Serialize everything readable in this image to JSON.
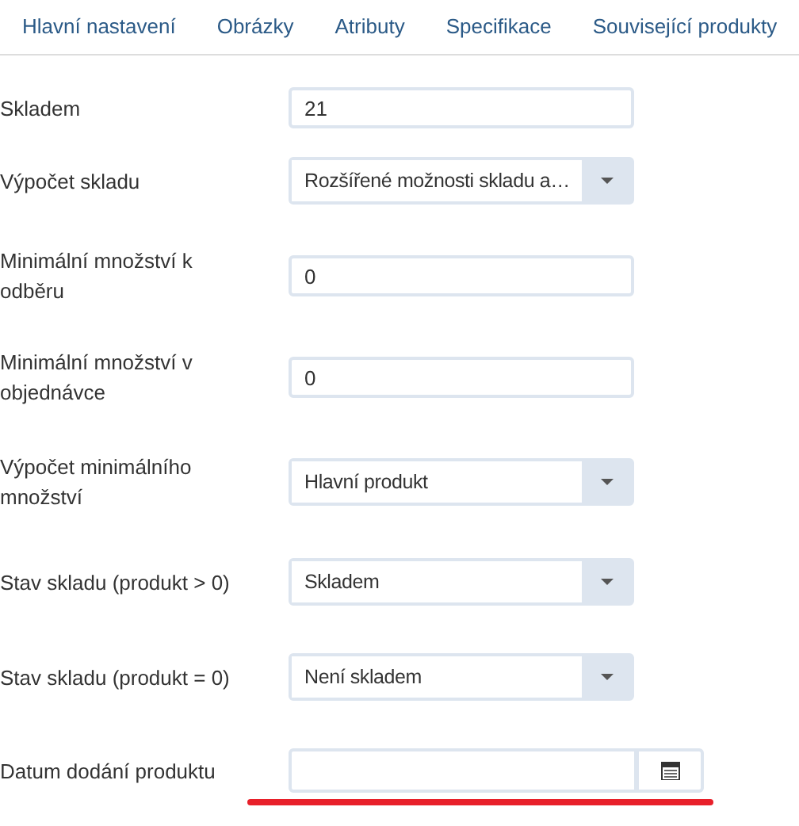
{
  "tabs": [
    {
      "label": "Hlavní nastavení"
    },
    {
      "label": "Obrázky"
    },
    {
      "label": "Atributy"
    },
    {
      "label": "Specifikace"
    },
    {
      "label": "Související produkty"
    }
  ],
  "fields": [
    {
      "label": "Skladem",
      "kind": "text",
      "value": "21"
    },
    {
      "label": "Výpočet skladu",
      "kind": "select",
      "value": "Rozšířené možnosti skladu a…"
    },
    {
      "label": "Minimální množství k odběru",
      "kind": "text",
      "value": "0"
    },
    {
      "label": "Minimální množství v objednávce",
      "kind": "text",
      "value": "0"
    },
    {
      "label": "Výpočet minimálního množství",
      "kind": "select",
      "value": "Hlavní produkt"
    },
    {
      "label": "Stav skladu (produkt > 0)",
      "kind": "select",
      "value": "Skladem"
    },
    {
      "label": "Stav skladu (produkt = 0)",
      "kind": "select",
      "value": "Není skladem"
    },
    {
      "label": "Datum dodání produktu",
      "kind": "date"
    }
  ]
}
